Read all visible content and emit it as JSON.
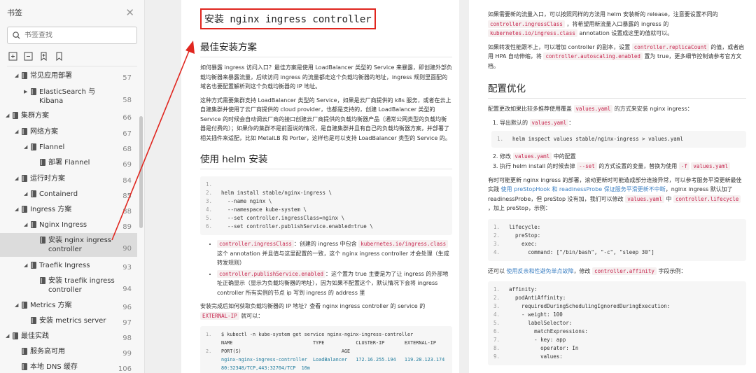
{
  "sidebar": {
    "title": "书签",
    "search_placeholder": "书签查找",
    "items": [
      {
        "label": "常见应用部署",
        "page": "57"
      },
      {
        "label": "ElasticSearch 与 Kibana",
        "page": "58"
      },
      {
        "label": "集群方案",
        "page": "66"
      },
      {
        "label": "网络方案",
        "page": "67"
      },
      {
        "label": "Flannel",
        "page": "68"
      },
      {
        "label": "部署 Flannel",
        "page": "69"
      },
      {
        "label": "运行时方案",
        "page": "84"
      },
      {
        "label": "Containerd",
        "page": "85"
      },
      {
        "label": "Ingress 方案",
        "page": "88"
      },
      {
        "label": "Nginx Ingress",
        "page": "89"
      },
      {
        "label": "安装 nginx ingress controller",
        "page": "90"
      },
      {
        "label": "Traefik Ingress",
        "page": "93"
      },
      {
        "label": "安装 traefik ingress controller",
        "page": "94"
      },
      {
        "label": "Metrics 方案",
        "page": "96"
      },
      {
        "label": "安装 metrics server",
        "page": "97"
      },
      {
        "label": "最佳实践",
        "page": "98"
      },
      {
        "label": "服务高可用",
        "page": "99"
      },
      {
        "label": "本地 DNS 缓存",
        "page": "106"
      }
    ]
  },
  "page1": {
    "title": "安装 nginx ingress controller",
    "h_best": "最佳安装方案",
    "para1": "如何暴露 ingress 访问入口？最佳方案是使用 LoadBalancer 类型的 Service 来暴露，即创建外部负载均衡器来暴露流量，后续访问 ingress 的流量都走这个负载均衡器的地址，ingress 规则里面配的域名也要配置解析到这个负载均衡器的 IP 地址。",
    "para2": "这种方式需要集群支持 LoadBalancer 类型的 Service，如果是云厂商提供的 k8s 服务，或者在云上自建集群并使用了云厂商提供的 cloud provider，也都是支持的，创建 LoadBalancer 类型的 Service 的时候会自动调云厂商的接口创建云厂商提供的负载均衡器产品（通常公网类型的负载均衡器是付费的）；如果你的集群不是前面说的情况，是自建集群并且有自己的负载均衡器方案，并部署了相关插件来适配，比如 MetalLB 和 Porter，这样也是可以支持 LoadBalancer 类型的 Service 的。",
    "h_helm": "使用 helm 安装",
    "helm_code": [
      "",
      "helm install stable/nginx-ingress \\",
      "  --name nginx \\",
      "  --namespace kube-system \\",
      "  --set controller.ingressClass=nginx \\",
      "  --set controller.publishService.enabled=true \\"
    ],
    "b1_code": "controller.ingressClass",
    "b1_text1": "：创建的 ingress 中包含",
    "b1_code2": "kubernetes.io/ingress.class",
    "b1_text2": "这个 annotation 并且值与这里配置的一致，这个 nginx ingress controller 才会处理（生成转发规则）",
    "b2_code": "controller.publishService.enabled",
    "b2_text": "：这个置为 true 主要是为了让 ingress 的外部地址正确显示（显示为负载均衡器的地址），因为如果不配置这个，默认情况下会将 ingress controller 所有实例的节点 ip 写到 ingress 的 address 里",
    "para3a": "安装完成后如何获取负载均衡器的 IP 地址？查看 nginx ingress controller 的 service 的",
    "para3_code": "EXTERNAL-IP",
    "para3b": "就可以：",
    "svc_code": [
      "$ kubectl -n kube-system get service nginx-nginx-ingress-controller",
      "NAME                            TYPE           CLUSTER-IP       EXTERNAL-IP",
      "PORT(S)                                   AGE",
      "nginx-nginx-ingress-controller  LoadBalancer   172.16.255.194   119.28.123.174",
      "80:32348/TCP,443:32704/TCP  10m"
    ]
  },
  "page2": {
    "p1a": "如果需要新的流量入口，可以按照同样的方法用 helm 安装新的 release，注意要设置不同的",
    "p1_code1": "controller.ingressClass",
    "p1b": "，将希望用新流量入口暴露的 ingress 的",
    "p1_code2": "kubernetes.io/ingress.class",
    "p1c": "annotation 设置成这里的值就可以。",
    "p2a": "如果转发性能跟不上，可以增加 controller 的副本，设置",
    "p2_code1": "controller.replicaCount",
    "p2b": "的值，或者启用 HPA 自动伸缩，将",
    "p2_code2": "controller.autoscaling.enabled",
    "p2c": "置为 true，更多细节控制请参考官方文档。",
    "h_opt": "配置优化",
    "p3a": "配置更改如果比较多推荐使用覆盖",
    "p3_code": "values.yaml",
    "p3b": "的方式来安装 nginx ingress：",
    "step1a": "导出默认的",
    "step1_code": "values.yaml",
    "step1b": "：",
    "step1_cmd": "helm inspect values stable/nginx-ingress > values.yaml",
    "step2a": "修改",
    "step2_code": "values.yaml",
    "step2b": "中的配置",
    "step3a": "执行 helm install 的时候去掉",
    "step3_code1": "--set",
    "step3b": "的方式设置的变量，替换为使用",
    "step3_code2": "-f",
    "step3_code3": "values.yaml",
    "p4a": "有时可能更新 nginx ingress 的部署，滚动更新时可能造成部分连接异常，可以参考服务平滑更新最佳实践",
    "p4_link": "使用 preStopHook 和 readinessProbe 保证服务平滑更新不中断",
    "p4b": "，nginx ingress 默认加了 readinessProbe，但 preStop 没有加，我们可以修改",
    "p4_code1": "values.yaml",
    "p4c": "中",
    "p4_code2": "controller.lifecycle",
    "p4d": "，加上 preStop，示例：",
    "lifecycle_code": [
      "lifecycle:",
      "  preStop:",
      "    exec:",
      "      command: [\"/bin/bash\", \"-c\", \"sleep 30\"]"
    ],
    "p5a": "还可以",
    "p5_link": "使用反亲和性避免单点故障",
    "p5b": "，修改",
    "p5_code": "controller.affinity",
    "p5c": "字段示例：",
    "affinity_code": [
      "affinity:",
      "  podAntiAffinity:",
      "    requiredDuringSchedulingIgnoredDuringExecution:",
      "    - weight: 100",
      "      labelSelector:",
      "        matchExpressions:",
      "        - key: app",
      "          operator: In",
      "          values:"
    ]
  },
  "colors": {
    "highlight_border": "#e0261f",
    "inline_code": "#c7254e",
    "link": "#4183c4"
  }
}
